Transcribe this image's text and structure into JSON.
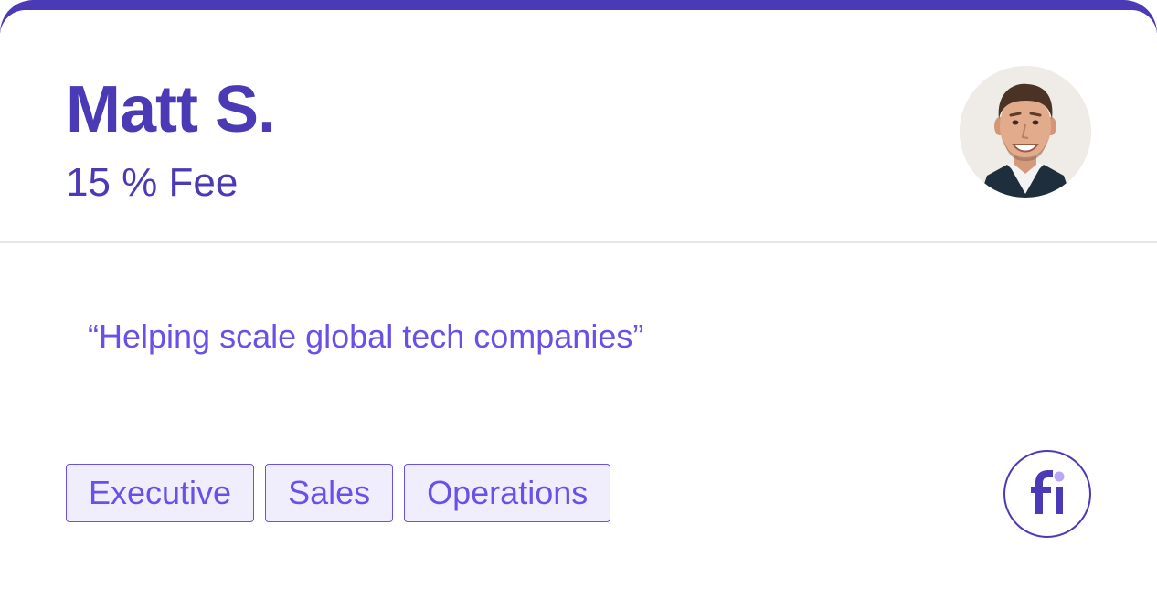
{
  "profile": {
    "name": "Matt S.",
    "fee": "15 % Fee",
    "quote": "“Helping scale global tech companies”",
    "tags": [
      "Executive",
      "Sales",
      "Operations"
    ]
  },
  "icons": {
    "avatar": "person-photo",
    "logo": "fi-logo"
  },
  "colors": {
    "brand": "#4b3ab6",
    "accent": "#6a50e8",
    "tag_bg": "#f0eefd",
    "divider": "#e6e6e9"
  }
}
